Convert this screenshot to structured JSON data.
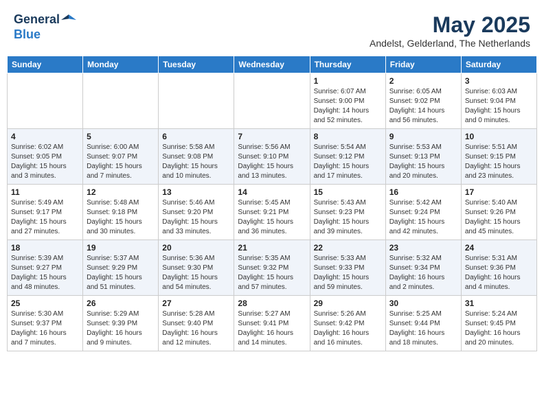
{
  "header": {
    "logo_line1": "General",
    "logo_line2": "Blue",
    "month": "May 2025",
    "location": "Andelst, Gelderland, The Netherlands"
  },
  "days_of_week": [
    "Sunday",
    "Monday",
    "Tuesday",
    "Wednesday",
    "Thursday",
    "Friday",
    "Saturday"
  ],
  "weeks": [
    [
      {
        "day": "",
        "info": ""
      },
      {
        "day": "",
        "info": ""
      },
      {
        "day": "",
        "info": ""
      },
      {
        "day": "",
        "info": ""
      },
      {
        "day": "1",
        "info": "Sunrise: 6:07 AM\nSunset: 9:00 PM\nDaylight: 14 hours\nand 52 minutes."
      },
      {
        "day": "2",
        "info": "Sunrise: 6:05 AM\nSunset: 9:02 PM\nDaylight: 14 hours\nand 56 minutes."
      },
      {
        "day": "3",
        "info": "Sunrise: 6:03 AM\nSunset: 9:04 PM\nDaylight: 15 hours\nand 0 minutes."
      }
    ],
    [
      {
        "day": "4",
        "info": "Sunrise: 6:02 AM\nSunset: 9:05 PM\nDaylight: 15 hours\nand 3 minutes."
      },
      {
        "day": "5",
        "info": "Sunrise: 6:00 AM\nSunset: 9:07 PM\nDaylight: 15 hours\nand 7 minutes."
      },
      {
        "day": "6",
        "info": "Sunrise: 5:58 AM\nSunset: 9:08 PM\nDaylight: 15 hours\nand 10 minutes."
      },
      {
        "day": "7",
        "info": "Sunrise: 5:56 AM\nSunset: 9:10 PM\nDaylight: 15 hours\nand 13 minutes."
      },
      {
        "day": "8",
        "info": "Sunrise: 5:54 AM\nSunset: 9:12 PM\nDaylight: 15 hours\nand 17 minutes."
      },
      {
        "day": "9",
        "info": "Sunrise: 5:53 AM\nSunset: 9:13 PM\nDaylight: 15 hours\nand 20 minutes."
      },
      {
        "day": "10",
        "info": "Sunrise: 5:51 AM\nSunset: 9:15 PM\nDaylight: 15 hours\nand 23 minutes."
      }
    ],
    [
      {
        "day": "11",
        "info": "Sunrise: 5:49 AM\nSunset: 9:17 PM\nDaylight: 15 hours\nand 27 minutes."
      },
      {
        "day": "12",
        "info": "Sunrise: 5:48 AM\nSunset: 9:18 PM\nDaylight: 15 hours\nand 30 minutes."
      },
      {
        "day": "13",
        "info": "Sunrise: 5:46 AM\nSunset: 9:20 PM\nDaylight: 15 hours\nand 33 minutes."
      },
      {
        "day": "14",
        "info": "Sunrise: 5:45 AM\nSunset: 9:21 PM\nDaylight: 15 hours\nand 36 minutes."
      },
      {
        "day": "15",
        "info": "Sunrise: 5:43 AM\nSunset: 9:23 PM\nDaylight: 15 hours\nand 39 minutes."
      },
      {
        "day": "16",
        "info": "Sunrise: 5:42 AM\nSunset: 9:24 PM\nDaylight: 15 hours\nand 42 minutes."
      },
      {
        "day": "17",
        "info": "Sunrise: 5:40 AM\nSunset: 9:26 PM\nDaylight: 15 hours\nand 45 minutes."
      }
    ],
    [
      {
        "day": "18",
        "info": "Sunrise: 5:39 AM\nSunset: 9:27 PM\nDaylight: 15 hours\nand 48 minutes."
      },
      {
        "day": "19",
        "info": "Sunrise: 5:37 AM\nSunset: 9:29 PM\nDaylight: 15 hours\nand 51 minutes."
      },
      {
        "day": "20",
        "info": "Sunrise: 5:36 AM\nSunset: 9:30 PM\nDaylight: 15 hours\nand 54 minutes."
      },
      {
        "day": "21",
        "info": "Sunrise: 5:35 AM\nSunset: 9:32 PM\nDaylight: 15 hours\nand 57 minutes."
      },
      {
        "day": "22",
        "info": "Sunrise: 5:33 AM\nSunset: 9:33 PM\nDaylight: 15 hours\nand 59 minutes."
      },
      {
        "day": "23",
        "info": "Sunrise: 5:32 AM\nSunset: 9:34 PM\nDaylight: 16 hours\nand 2 minutes."
      },
      {
        "day": "24",
        "info": "Sunrise: 5:31 AM\nSunset: 9:36 PM\nDaylight: 16 hours\nand 4 minutes."
      }
    ],
    [
      {
        "day": "25",
        "info": "Sunrise: 5:30 AM\nSunset: 9:37 PM\nDaylight: 16 hours\nand 7 minutes."
      },
      {
        "day": "26",
        "info": "Sunrise: 5:29 AM\nSunset: 9:39 PM\nDaylight: 16 hours\nand 9 minutes."
      },
      {
        "day": "27",
        "info": "Sunrise: 5:28 AM\nSunset: 9:40 PM\nDaylight: 16 hours\nand 12 minutes."
      },
      {
        "day": "28",
        "info": "Sunrise: 5:27 AM\nSunset: 9:41 PM\nDaylight: 16 hours\nand 14 minutes."
      },
      {
        "day": "29",
        "info": "Sunrise: 5:26 AM\nSunset: 9:42 PM\nDaylight: 16 hours\nand 16 minutes."
      },
      {
        "day": "30",
        "info": "Sunrise: 5:25 AM\nSunset: 9:44 PM\nDaylight: 16 hours\nand 18 minutes."
      },
      {
        "day": "31",
        "info": "Sunrise: 5:24 AM\nSunset: 9:45 PM\nDaylight: 16 hours\nand 20 minutes."
      }
    ]
  ]
}
